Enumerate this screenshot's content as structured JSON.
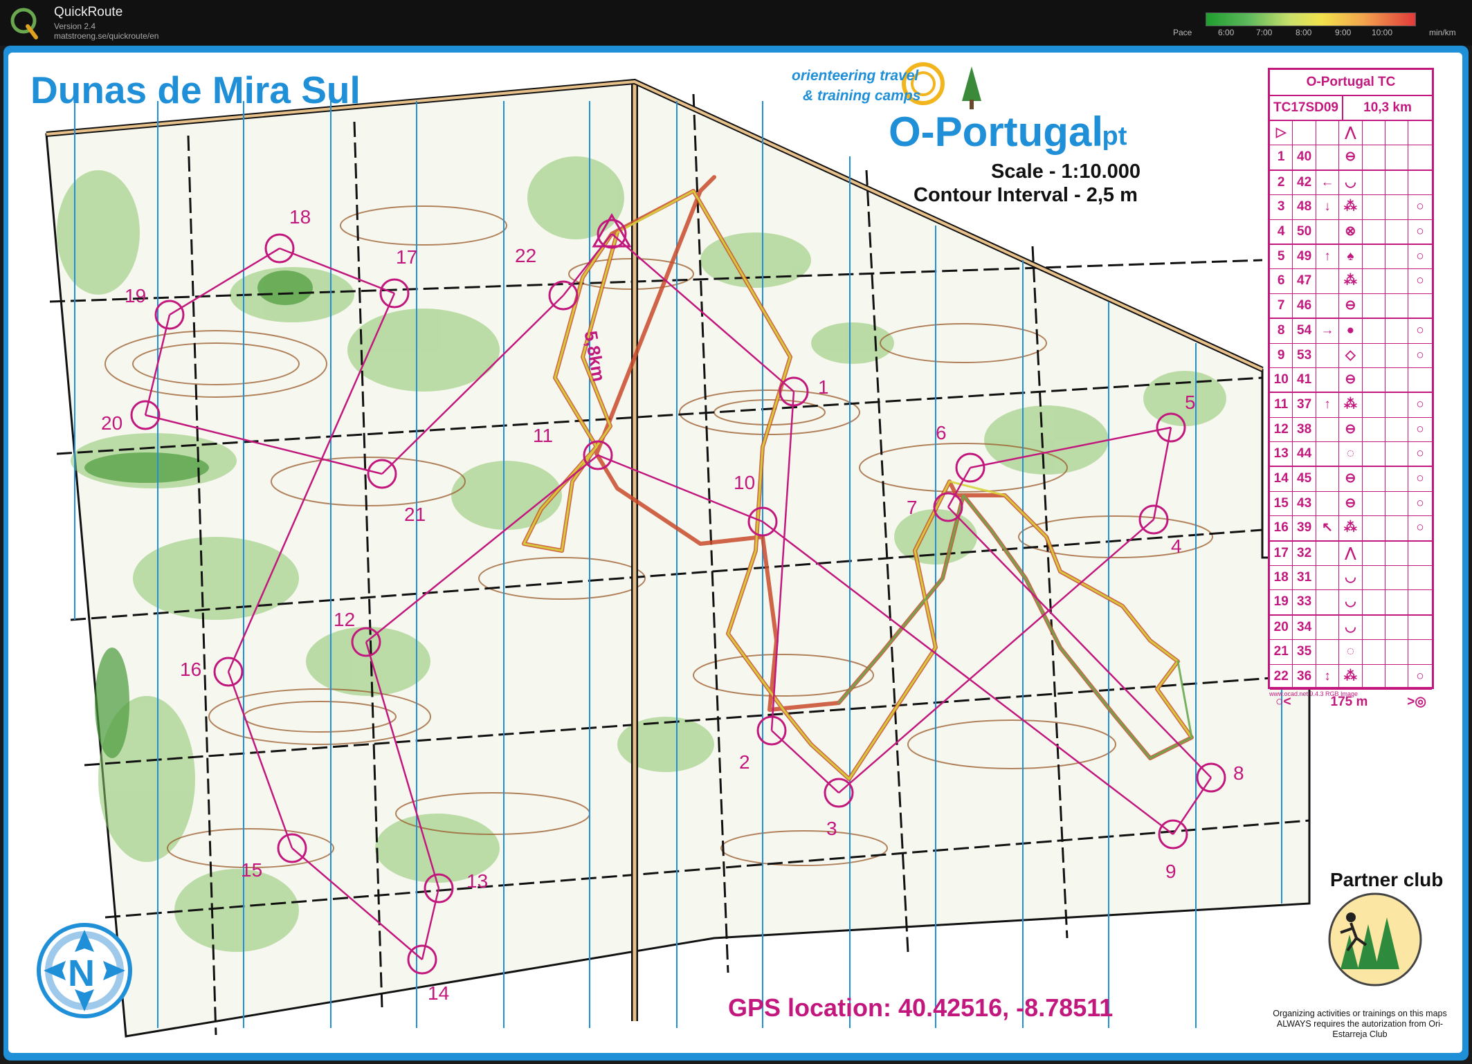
{
  "app": {
    "title": "QuickRoute",
    "version": "Version 2.4",
    "url": "matstroeng.se/quickroute/en",
    "pace_label": "Pace",
    "pace_ticks": [
      "6:00",
      "7:00",
      "8:00",
      "9:00",
      "10:00"
    ],
    "pace_unit": "min/km"
  },
  "map": {
    "title": "Dunas de Mira Sul",
    "brand_line1": "orienteering travel",
    "brand_line2": "& training camps",
    "brand_name": "O-Portugal",
    "brand_tld": ".pt",
    "scale": "Scale - 1:10.000",
    "contour": "Contour Interval -  2,5 m",
    "course_length_label": "5,8km",
    "gps": "GPS location: 40.42516, -8.78511",
    "partner": "Partner club",
    "legal": "Organizing activities or trainings on this maps ALWAYS requires the autorization from Ori-Estarreja Club",
    "credit": "www.ocad.net 9.4.3 RGB Image",
    "club_name": "ORI Estarreja",
    "north_letter": "N",
    "colors": {
      "course": "#c2187e",
      "frame": "#1f8fd8",
      "forest": "#8cc56b",
      "contour": "#9a5a2b"
    }
  },
  "controls": [
    {
      "n": "1"
    },
    {
      "n": "2"
    },
    {
      "n": "3"
    },
    {
      "n": "4"
    },
    {
      "n": "5"
    },
    {
      "n": "6"
    },
    {
      "n": "7"
    },
    {
      "n": "8"
    },
    {
      "n": "9"
    },
    {
      "n": "10"
    },
    {
      "n": "11"
    },
    {
      "n": "12"
    },
    {
      "n": "13"
    },
    {
      "n": "14"
    },
    {
      "n": "15"
    },
    {
      "n": "16"
    },
    {
      "n": "17"
    },
    {
      "n": "18"
    },
    {
      "n": "19"
    },
    {
      "n": "20"
    },
    {
      "n": "21"
    },
    {
      "n": "22"
    }
  ],
  "description_sheet": {
    "event": "O-Portugal TC",
    "course_id": "TC17SD09",
    "course_length": "10,3 km",
    "rows": [
      {
        "num": "1",
        "code": "40",
        "dir": "",
        "feat": "⊖",
        "extra": ""
      },
      {
        "num": "2",
        "code": "42",
        "dir": "←",
        "feat": "◡",
        "extra": ""
      },
      {
        "num": "3",
        "code": "48",
        "dir": "↓",
        "feat": "⁂",
        "extra": "○"
      },
      {
        "num": "4",
        "code": "50",
        "dir": "",
        "feat": "⊗",
        "extra": "○"
      },
      {
        "num": "5",
        "code": "49",
        "dir": "↑",
        "feat": "♠",
        "extra": "○"
      },
      {
        "num": "6",
        "code": "47",
        "dir": "",
        "feat": "⁂",
        "extra": "○"
      },
      {
        "num": "7",
        "code": "46",
        "dir": "",
        "feat": "⊖",
        "extra": ""
      },
      {
        "num": "8",
        "code": "54",
        "dir": "→",
        "feat": "●",
        "extra": "○"
      },
      {
        "num": "9",
        "code": "53",
        "dir": "",
        "feat": "◇",
        "extra": "○"
      },
      {
        "num": "10",
        "code": "41",
        "dir": "",
        "feat": "⊖",
        "extra": ""
      },
      {
        "num": "11",
        "code": "37",
        "dir": "↑",
        "feat": "⁂",
        "extra": "○"
      },
      {
        "num": "12",
        "code": "38",
        "dir": "",
        "feat": "⊖",
        "extra": "○"
      },
      {
        "num": "13",
        "code": "44",
        "dir": "",
        "feat": "◌",
        "extra": "○"
      },
      {
        "num": "14",
        "code": "45",
        "dir": "",
        "feat": "⊖",
        "extra": "○"
      },
      {
        "num": "15",
        "code": "43",
        "dir": "",
        "feat": "⊖",
        "extra": "○"
      },
      {
        "num": "16",
        "code": "39",
        "dir": "↖",
        "feat": "⁂",
        "extra": "○"
      },
      {
        "num": "17",
        "code": "32",
        "dir": "",
        "feat": "⋀",
        "extra": ""
      },
      {
        "num": "18",
        "code": "31",
        "dir": "",
        "feat": "◡",
        "extra": ""
      },
      {
        "num": "19",
        "code": "33",
        "dir": "",
        "feat": "◡",
        "extra": ""
      },
      {
        "num": "20",
        "code": "34",
        "dir": "",
        "feat": "◡",
        "extra": ""
      },
      {
        "num": "21",
        "code": "35",
        "dir": "",
        "feat": "◌",
        "extra": ""
      },
      {
        "num": "22",
        "code": "36",
        "dir": "↕",
        "feat": "⁂",
        "extra": "○"
      }
    ],
    "start_symbol": "▷",
    "start_feature": "⋀",
    "finish_length": "175 m",
    "finish_left": "○<",
    "finish_right": ">◎"
  }
}
